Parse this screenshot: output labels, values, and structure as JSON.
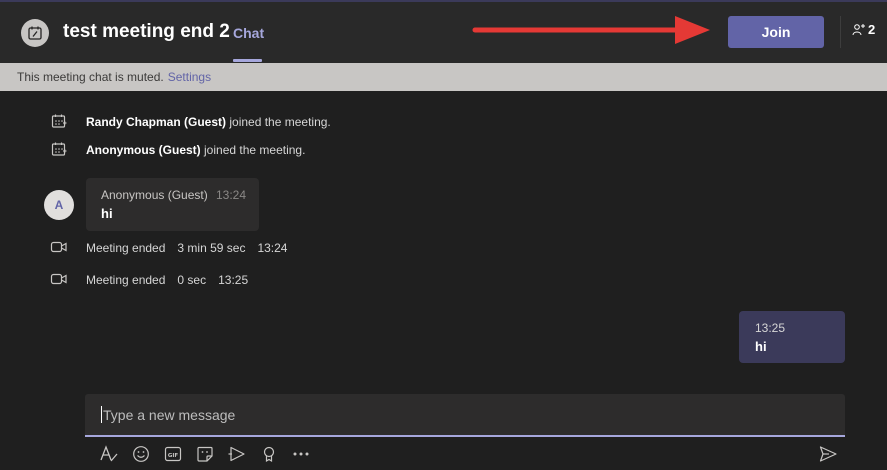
{
  "header": {
    "title": "test meeting end 2",
    "tab_chat": "Chat",
    "join_label": "Join",
    "participant_count": "2"
  },
  "banner": {
    "text": "This meeting chat is muted.",
    "link": "Settings"
  },
  "events": [
    {
      "name": "Randy Chapman (Guest)",
      "text": "joined the meeting."
    },
    {
      "name": "Anonymous (Guest)",
      "text": "joined the meeting."
    }
  ],
  "message": {
    "avatar_initial": "A",
    "author": "Anonymous (Guest)",
    "time": "13:24",
    "text": "hi"
  },
  "meeting_ended": [
    {
      "label": "Meeting ended",
      "duration": "3 min 59 sec",
      "time": "13:24"
    },
    {
      "label": "Meeting ended",
      "duration": "0 sec",
      "time": "13:25"
    }
  ],
  "my_message": {
    "time": "13:25",
    "text": "hi"
  },
  "compose": {
    "placeholder": "Type a new message"
  },
  "toolbar": {
    "icons": [
      "format-icon",
      "emoji-icon",
      "gif-icon",
      "sticker-icon",
      "meet-now-icon",
      "praise-icon",
      "more-options-icon",
      "send-icon"
    ]
  },
  "colors": {
    "accent": "#6264a7",
    "accent_light": "#a6a7dc",
    "background": "#1f1f1f",
    "header": "#292929",
    "bubble": "#2d2c2c",
    "my_bubble": "#3b3a5a",
    "banner": "#c8c6c4",
    "arrow": "#e53935"
  }
}
